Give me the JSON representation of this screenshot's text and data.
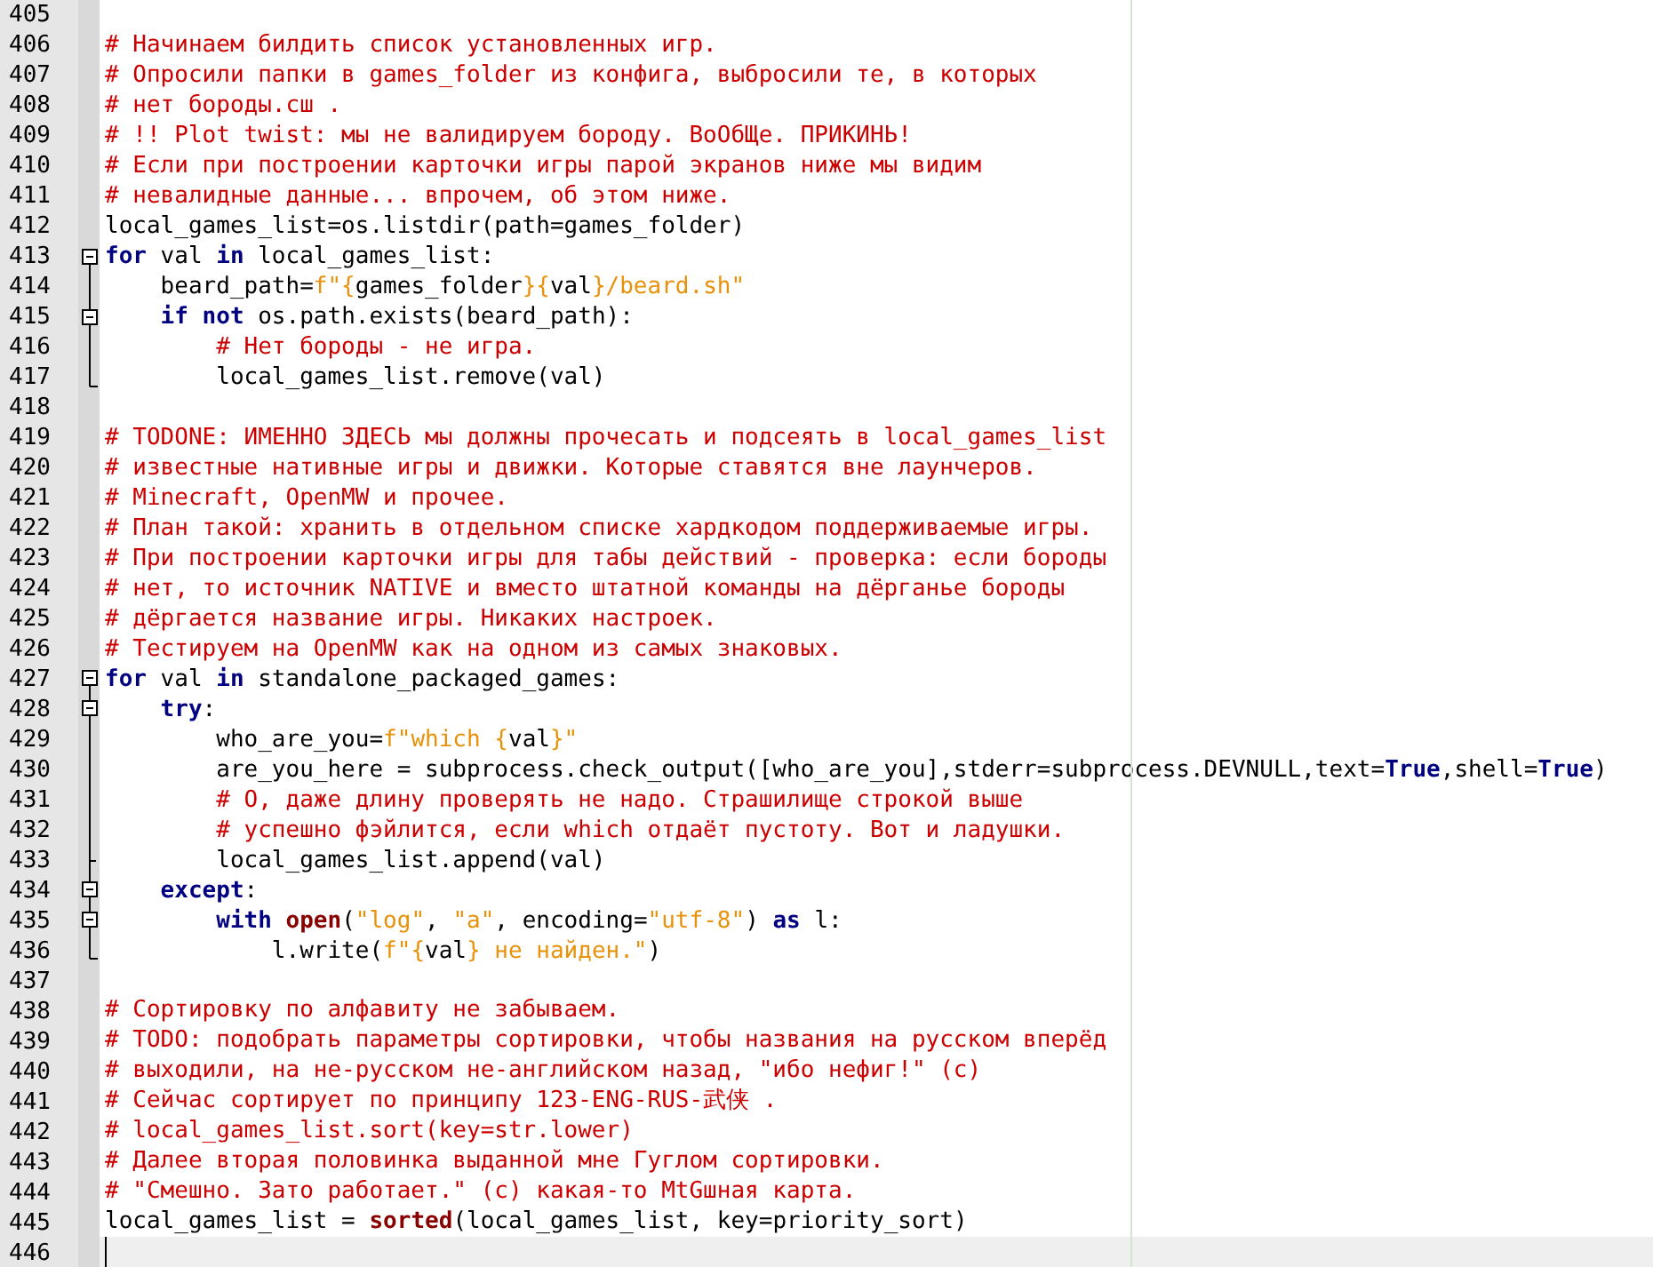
{
  "editor": {
    "lines": [
      {
        "number": "405",
        "kind": "plain"
      },
      {
        "number": "406",
        "kind": "plain",
        "tokens": [
          {
            "kind": "comment",
            "text": "# Начинаем билдить список установленных игр."
          }
        ]
      },
      {
        "number": "407",
        "kind": "plain",
        "tokens": [
          {
            "kind": "comment",
            "text": "# Опросили папки в games_folder из конфига, выбросили те, в которых"
          }
        ]
      },
      {
        "number": "408",
        "kind": "plain",
        "tokens": [
          {
            "kind": "comment",
            "text": "# нет бороды.сш ."
          }
        ]
      },
      {
        "number": "409",
        "kind": "plain",
        "tokens": [
          {
            "kind": "comment",
            "text": "# !! Plot twist: мы не валидируем бороду. ВоОбЩе. ПРИКИНЬ!"
          }
        ]
      },
      {
        "number": "410",
        "kind": "plain",
        "tokens": [
          {
            "kind": "comment",
            "text": "# Если при построении карточки игры парой экранов ниже мы видим"
          }
        ]
      },
      {
        "number": "411",
        "kind": "plain",
        "tokens": [
          {
            "kind": "comment",
            "text": "# невалидные данные... впрочем, об этом ниже."
          }
        ]
      },
      {
        "number": "412",
        "kind": "plain",
        "tokens": [
          {
            "kind": "plain",
            "text": "local_games_list=os.listdir(path=games_folder)"
          }
        ]
      },
      {
        "number": "413",
        "kind": "fold-open",
        "tokens": [
          {
            "kind": "keyword",
            "text": "for"
          },
          {
            "kind": "plain",
            "text": " val "
          },
          {
            "kind": "keyword",
            "text": "in"
          },
          {
            "kind": "plain",
            "text": " local_games_list:"
          }
        ]
      },
      {
        "number": "414",
        "kind": "fold-line",
        "tokens": [
          {
            "kind": "plain",
            "text": "    beard_path="
          },
          {
            "kind": "string",
            "text": "f\"{"
          },
          {
            "kind": "plain",
            "text": "games_folder"
          },
          {
            "kind": "string",
            "text": "}{"
          },
          {
            "kind": "plain",
            "text": "val"
          },
          {
            "kind": "string",
            "text": "}/beard.sh\""
          }
        ]
      },
      {
        "number": "415",
        "kind": "fold-open-inner",
        "tokens": [
          {
            "kind": "keyword",
            "text": "    if "
          },
          {
            "kind": "keyword",
            "text": "not"
          },
          {
            "kind": "plain",
            "text": " os.path.exists(beard_path):"
          }
        ]
      },
      {
        "number": "416",
        "kind": "fold-line",
        "tokens": [
          {
            "kind": "comment",
            "text": "        # Нет бороды - не игра."
          }
        ]
      },
      {
        "number": "417",
        "kind": "fold-end",
        "tokens": [
          {
            "kind": "plain",
            "text": "        local_games_list.remove(val)"
          }
        ]
      },
      {
        "number": "418",
        "kind": "plain"
      },
      {
        "number": "419",
        "kind": "plain",
        "tokens": [
          {
            "kind": "comment",
            "text": "# TODONE: ИМЕННО ЗДЕСЬ мы должны прочесать и подсеять в local_games_list"
          }
        ]
      },
      {
        "number": "420",
        "kind": "plain",
        "tokens": [
          {
            "kind": "comment",
            "text": "# известные нативные игры и движки. Которые ставятся вне лаунчеров."
          }
        ]
      },
      {
        "number": "421",
        "kind": "plain",
        "tokens": [
          {
            "kind": "comment",
            "text": "# Minecraft, OpenMW и прочее."
          }
        ]
      },
      {
        "number": "422",
        "kind": "plain",
        "tokens": [
          {
            "kind": "comment",
            "text": "# План такой: хранить в отдельном списке хардкодом поддерживаемые игры."
          }
        ]
      },
      {
        "number": "423",
        "kind": "plain",
        "tokens": [
          {
            "kind": "comment",
            "text": "# При построении карточки игры для табы действий - проверка: если бороды"
          }
        ]
      },
      {
        "number": "424",
        "kind": "plain",
        "tokens": [
          {
            "kind": "comment",
            "text": "# нет, то источник NATIVE и вместо штатной команды на дёрганье бороды"
          }
        ]
      },
      {
        "number": "425",
        "kind": "plain",
        "tokens": [
          {
            "kind": "comment",
            "text": "# дёргается название игры. Никаких настроек."
          }
        ]
      },
      {
        "number": "426",
        "kind": "plain",
        "tokens": [
          {
            "kind": "comment",
            "text": "# Тестируем на OpenMW как на одном из самых знаковых."
          }
        ]
      },
      {
        "number": "427",
        "kind": "fold-open",
        "tokens": [
          {
            "kind": "keyword",
            "text": "for"
          },
          {
            "kind": "plain",
            "text": " val "
          },
          {
            "kind": "keyword",
            "text": "in"
          },
          {
            "kind": "plain",
            "text": " standalone_packaged_games:"
          }
        ]
      },
      {
        "number": "428",
        "kind": "fold-open-inner",
        "tokens": [
          {
            "kind": "keyword",
            "text": "    try"
          },
          {
            "kind": "plain",
            "text": ":"
          }
        ]
      },
      {
        "number": "429",
        "kind": "fold-line",
        "tokens": [
          {
            "kind": "plain",
            "text": "        who_are_you="
          },
          {
            "kind": "string",
            "text": "f\"which {"
          },
          {
            "kind": "plain",
            "text": "val"
          },
          {
            "kind": "string",
            "text": "}\""
          }
        ]
      },
      {
        "number": "430",
        "kind": "fold-line",
        "tokens": [
          {
            "kind": "plain",
            "text": "        are_you_here = subprocess.check_output([who_are_you],stderr=subprocess.DEVNULL,text="
          },
          {
            "kind": "keyword",
            "text": "True"
          },
          {
            "kind": "plain",
            "text": ",shell="
          },
          {
            "kind": "keyword",
            "text": "True"
          },
          {
            "kind": "plain",
            "text": ")"
          }
        ]
      },
      {
        "number": "431",
        "kind": "fold-line",
        "tokens": [
          {
            "kind": "comment",
            "text": "        # О, даже длину проверять не надо. Страшилище строкой выше"
          }
        ]
      },
      {
        "number": "432",
        "kind": "fold-line",
        "tokens": [
          {
            "kind": "comment",
            "text": "        # успешно фэйлится, если which отдаёт пустоту. Вот и ладушки."
          }
        ]
      },
      {
        "number": "433",
        "kind": "fold-branch-end",
        "tokens": [
          {
            "kind": "plain",
            "text": "        local_games_list.append(val)"
          }
        ]
      },
      {
        "number": "434",
        "kind": "fold-open-inner",
        "tokens": [
          {
            "kind": "keyword",
            "text": "    except"
          },
          {
            "kind": "plain",
            "text": ":"
          }
        ]
      },
      {
        "number": "435",
        "kind": "fold-open-inner",
        "tokens": [
          {
            "kind": "keyword",
            "text": "        with "
          },
          {
            "kind": "builtin",
            "text": "open"
          },
          {
            "kind": "plain",
            "text": "("
          },
          {
            "kind": "string",
            "text": "\"log\""
          },
          {
            "kind": "plain",
            "text": ", "
          },
          {
            "kind": "string",
            "text": "\"a\""
          },
          {
            "kind": "plain",
            "text": ", encoding="
          },
          {
            "kind": "string",
            "text": "\"utf-8\""
          },
          {
            "kind": "plain",
            "text": ") "
          },
          {
            "kind": "keyword",
            "text": "as"
          },
          {
            "kind": "plain",
            "text": " l:"
          }
        ]
      },
      {
        "number": "436",
        "kind": "fold-end",
        "tokens": [
          {
            "kind": "plain",
            "text": "            l.write("
          },
          {
            "kind": "string",
            "text": "f\"{"
          },
          {
            "kind": "plain",
            "text": "val"
          },
          {
            "kind": "string",
            "text": "} не найден.\""
          },
          {
            "kind": "plain",
            "text": ")"
          }
        ]
      },
      {
        "number": "437",
        "kind": "plain"
      },
      {
        "number": "438",
        "kind": "plain",
        "tokens": [
          {
            "kind": "comment",
            "text": "# Сортировку по алфавиту не забываем."
          }
        ]
      },
      {
        "number": "439",
        "kind": "plain",
        "tokens": [
          {
            "kind": "comment",
            "text": "# TODO: подобрать параметры сортировки, чтобы названия на русском вперёд"
          }
        ]
      },
      {
        "number": "440",
        "kind": "plain",
        "tokens": [
          {
            "kind": "comment",
            "text": "# выходили, на не-русском не-английском назад, \"ибо нефиг!\" (с)"
          }
        ]
      },
      {
        "number": "441",
        "kind": "plain",
        "tokens": [
          {
            "kind": "comment",
            "text": "# Сейчас сортирует по принципу 123-ENG-RUS-武侠 ."
          }
        ]
      },
      {
        "number": "442",
        "kind": "plain",
        "tokens": [
          {
            "kind": "comment",
            "text": "# local_games_list.sort(key=str.lower)"
          }
        ]
      },
      {
        "number": "443",
        "kind": "plain",
        "tokens": [
          {
            "kind": "comment",
            "text": "# Далее вторая половинка выданной мне Гуглом сортировки."
          }
        ]
      },
      {
        "number": "444",
        "kind": "plain",
        "tokens": [
          {
            "kind": "comment",
            "text": "# \"Смешно. Зато работает.\" (с) какая-то MtGшная карта."
          }
        ]
      },
      {
        "number": "445",
        "kind": "plain",
        "tokens": [
          {
            "kind": "plain",
            "text": "local_games_list = "
          },
          {
            "kind": "builtin",
            "text": "sorted"
          },
          {
            "kind": "plain",
            "text": "(local_games_list, key=priority_sort)"
          }
        ]
      },
      {
        "number": "446",
        "kind": "plain",
        "current": true
      }
    ]
  }
}
